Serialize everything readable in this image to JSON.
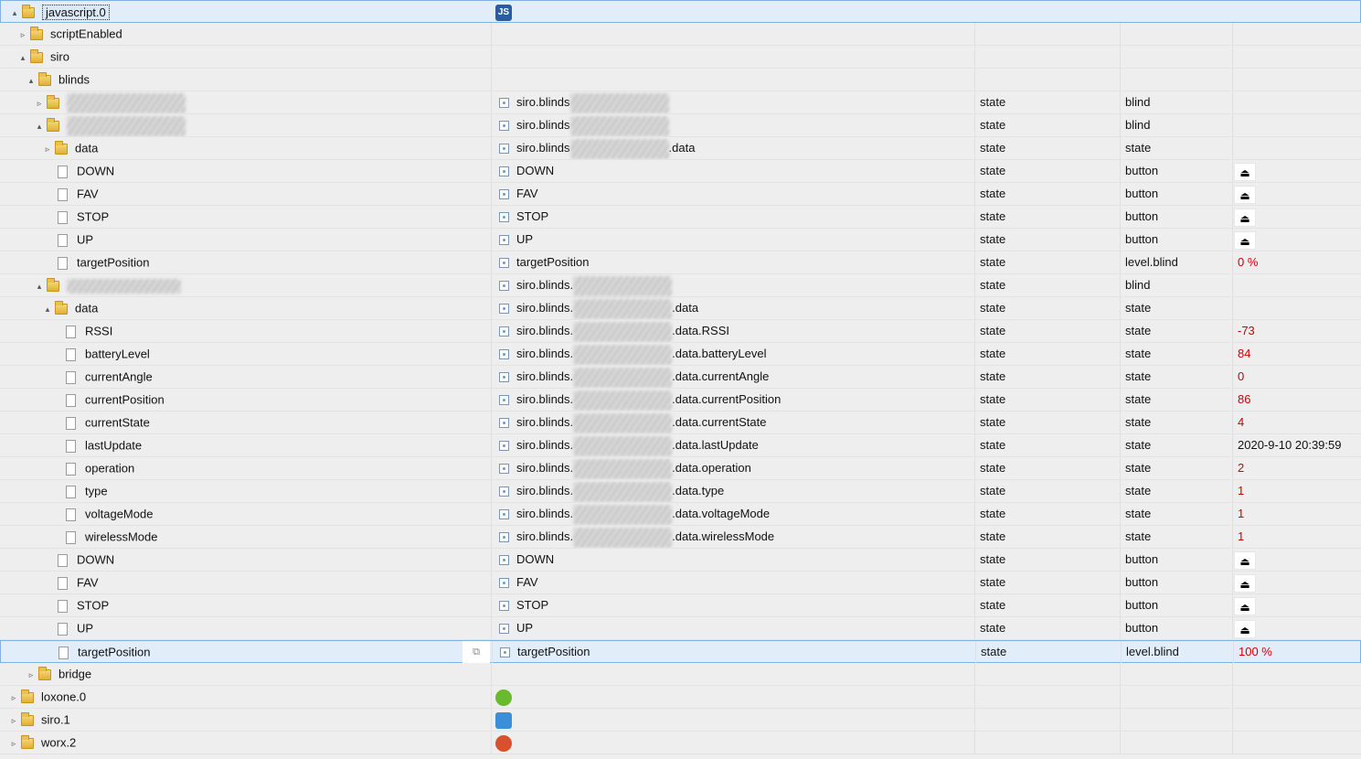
{
  "colors": {
    "value_red": "#cc0000",
    "selected_row": "#e1eefa",
    "folder": "#e0b036"
  },
  "icons": {
    "expanded": "▴",
    "collapsed": "▹",
    "button": "⏏",
    "copy": "⧉",
    "js": "JS"
  },
  "rows": {
    "r0": {
      "name": "javascript.0"
    },
    "r1": {
      "name": "scriptEnabled"
    },
    "r2": {
      "name": "siro"
    },
    "r3": {
      "name": "blinds"
    },
    "r4": {
      "id_prefix": "siro.blinds",
      "type": "state",
      "role": "blind"
    },
    "r5": {
      "id_prefix": "siro.blinds",
      "type": "state",
      "role": "blind"
    },
    "r6": {
      "name": "data",
      "id_prefix": "siro.blinds",
      "id_suffix": ".data",
      "type": "state",
      "role": "state"
    },
    "r7": {
      "name": "DOWN",
      "id": "DOWN",
      "type": "state",
      "role": "button"
    },
    "r8": {
      "name": "FAV",
      "id": "FAV",
      "type": "state",
      "role": "button"
    },
    "r9": {
      "name": "STOP",
      "id": "STOP",
      "type": "state",
      "role": "button"
    },
    "r10": {
      "name": "UP",
      "id": "UP",
      "type": "state",
      "role": "button"
    },
    "r11": {
      "name": "targetPosition",
      "id": "targetPosition",
      "type": "state",
      "role": "level.blind",
      "value": "0 %"
    },
    "r12": {
      "id_prefix": "siro.blinds.",
      "type": "state",
      "role": "blind"
    },
    "r13": {
      "name": "data",
      "id_prefix": "siro.blinds.",
      "id_suffix": ".data",
      "type": "state",
      "role": "state"
    },
    "r14": {
      "name": "RSSI",
      "id_prefix": "siro.blinds.",
      "id_suffix": ".data.RSSI",
      "type": "state",
      "role": "state",
      "value": "-73"
    },
    "r15": {
      "name": "batteryLevel",
      "id_prefix": "siro.blinds.",
      "id_suffix": ".data.batteryLevel",
      "type": "state",
      "role": "state",
      "value": "84"
    },
    "r16": {
      "name": "currentAngle",
      "id_prefix": "siro.blinds.",
      "id_suffix": ".data.currentAngle",
      "type": "state",
      "role": "state",
      "value": "0"
    },
    "r17": {
      "name": "currentPosition",
      "id_prefix": "siro.blinds.",
      "id_suffix": ".data.currentPosition",
      "type": "state",
      "role": "state",
      "value": "86"
    },
    "r18": {
      "name": "currentState",
      "id_prefix": "siro.blinds.",
      "id_suffix": ".data.currentState",
      "type": "state",
      "role": "state",
      "value": "4"
    },
    "r19": {
      "name": "lastUpdate",
      "id_prefix": "siro.blinds.",
      "id_suffix": ".data.lastUpdate",
      "type": "state",
      "role": "state",
      "value": "2020-9-10 20:39:59"
    },
    "r20": {
      "name": "operation",
      "id_prefix": "siro.blinds.",
      "id_suffix": ".data.operation",
      "type": "state",
      "role": "state",
      "value": "2"
    },
    "r21": {
      "name": "type",
      "id_prefix": "siro.blinds.",
      "id_suffix": ".data.type",
      "type": "state",
      "role": "state",
      "value": "1"
    },
    "r22": {
      "name": "voltageMode",
      "id_prefix": "siro.blinds.",
      "id_suffix": ".data.voltageMode",
      "type": "state",
      "role": "state",
      "value": "1"
    },
    "r23": {
      "name": "wirelessMode",
      "id_prefix": "siro.blinds.",
      "id_suffix": ".data.wirelessMode",
      "type": "state",
      "role": "state",
      "value": "1"
    },
    "r24": {
      "name": "DOWN",
      "id": "DOWN",
      "type": "state",
      "role": "button"
    },
    "r25": {
      "name": "FAV",
      "id": "FAV",
      "type": "state",
      "role": "button"
    },
    "r26": {
      "name": "STOP",
      "id": "STOP",
      "type": "state",
      "role": "button"
    },
    "r27": {
      "name": "UP",
      "id": "UP",
      "type": "state",
      "role": "button"
    },
    "r28": {
      "name": "targetPosition",
      "id": "targetPosition",
      "type": "state",
      "role": "level.blind",
      "value": "100 %"
    },
    "r29": {
      "name": "bridge"
    },
    "r30": {
      "name": "loxone.0"
    },
    "r31": {
      "name": "siro.1"
    },
    "r32": {
      "name": "worx.2"
    }
  }
}
